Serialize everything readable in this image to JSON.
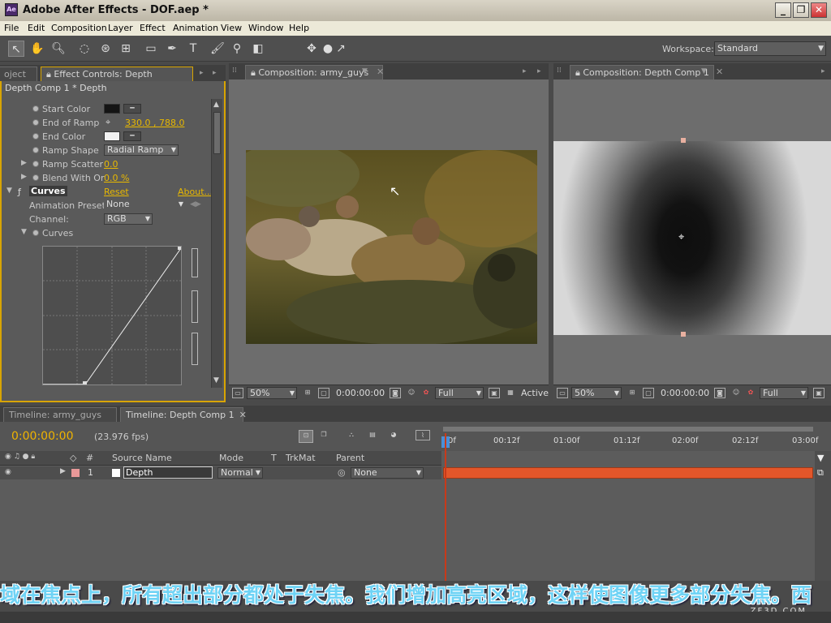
{
  "app": {
    "title": "Adobe After Effects - DOF.aep *",
    "window_buttons": [
      "_",
      "❐",
      "✕"
    ]
  },
  "menu": [
    "File",
    "Edit",
    "Composition",
    "Layer",
    "Effect",
    "Animation",
    "View",
    "Window",
    "Help"
  ],
  "toolbar": {
    "tools": [
      "selection-tool",
      "hand-tool",
      "zoom-tool",
      "rotation-tool",
      "orbit-camera-tool",
      "pan-behind-tool",
      "rectangle-mask-tool",
      "pen-tool",
      "type-tool",
      "brush-tool",
      "clone-stamp-tool",
      "eraser-tool",
      "puppet-pin-tool"
    ],
    "workspace_label": "Workspace:",
    "workspace_value": "Standard"
  },
  "effect_controls": {
    "tab_partial": "oject",
    "tab": "Effect Controls: Depth",
    "header": "Depth Comp 1 * Depth",
    "rows": {
      "start_color": "Start Color",
      "end_of_ramp": "End of Ramp",
      "end_of_ramp_value": "330.0 , 788.0",
      "end_color": "End Color",
      "ramp_shape": "Ramp Shape",
      "ramp_shape_value": "Radial Ramp",
      "ramp_scatter": "Ramp Scatter",
      "ramp_scatter_value": "0.0",
      "blend_with_original": "Blend With Or",
      "blend_value": "0.0 %",
      "curves": "Curves",
      "reset": "Reset",
      "about": "About...",
      "animation_presets": "Animation Presets",
      "animation_presets_value": "None",
      "channel": "Channel:",
      "channel_value": "RGB",
      "curves_sub": "Curves"
    },
    "colors": {
      "start": "#141414",
      "end": "#f2f2f2"
    }
  },
  "comp_army": {
    "tab": "Composition: army_guys",
    "zoom": "50%",
    "timecode": "0:00:00:00",
    "resolution": "Full",
    "view": "Active"
  },
  "comp_depth": {
    "tab": "Composition: Depth Comp 1",
    "zoom": "50%",
    "timecode": "0:00:00:00",
    "resolution": "Full"
  },
  "timeline": {
    "tabs": [
      "Timeline: army_guys",
      "Timeline: Depth Comp 1"
    ],
    "current_time": "0:00:00:00",
    "fps": "(23.976 fps)",
    "columns": {
      "hash": "#",
      "source": "Source Name",
      "mode": "Mode",
      "t": "T",
      "trkmat": "TrkMat",
      "parent": "Parent"
    },
    "layer": {
      "index": "1",
      "name": "Depth",
      "mode": "Normal",
      "parent": "None"
    },
    "ruler": [
      "0f",
      "00:12f",
      "01:00f",
      "01:12f",
      "02:00f",
      "02:12f",
      "03:00f"
    ],
    "bar_color": "#e3562a"
  },
  "subtitle": "域在焦点上，所有超出部分都处于失焦。我们增加高亮区域，这样使图像更多部分失焦。西",
  "watermark": "ZF3D.COM"
}
